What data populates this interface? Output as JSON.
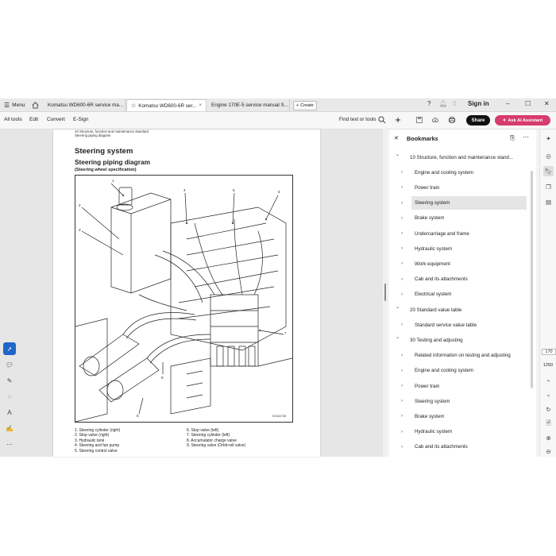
{
  "tabbar": {
    "menu_label": "Menu",
    "tabs": [
      {
        "label": "Komatsu WD600-6R service ma..."
      },
      {
        "label": "Komatsu WD600-6R ser..."
      },
      {
        "label": "Engine 170E-5 service manual S..."
      }
    ],
    "new_tab_label": "Create",
    "sign_in_label": "Sign in"
  },
  "toolbar": {
    "menus": [
      "All tools",
      "Edit",
      "Convert",
      "E-Sign"
    ],
    "find_label": "Find text or tools",
    "share_label": "Share",
    "ai_label": "Ask AI Assistant"
  },
  "document": {
    "header_line1": "10 Structure, function and maintenance standard",
    "header_line2": "Steering piping diagram",
    "title": "Steering system",
    "subtitle": "Steering piping diagram",
    "spec": "(Steering wheel specification)",
    "figure_id": "SJ154738",
    "legend_left": [
      "1.    Steering cylinder (right)",
      "2.    Stop valve (right)",
      "3.    Hydraulic tank",
      "4.    Steering and fan pump",
      "5.    Steering control valve"
    ],
    "legend_right": [
      "6.    Stop valve (left)",
      "7.    Steering cylinder (left)",
      "8.    Accumulator charge valve",
      "9.    Steering valve (Orbit-roll valve)"
    ],
    "callouts": [
      "1",
      "2",
      "3",
      "4",
      "5",
      "6",
      "7",
      "8",
      "9"
    ]
  },
  "bookmarks": {
    "title": "Bookmarks",
    "items": [
      {
        "label": "10 Structure, function and maintenance stand...",
        "level": 0,
        "expanded": true
      },
      {
        "label": "Engine and cooling system",
        "level": 1
      },
      {
        "label": "Power train",
        "level": 1
      },
      {
        "label": "Steering system",
        "level": 1,
        "selected": true
      },
      {
        "label": "Brake system",
        "level": 1
      },
      {
        "label": "Undercarriage and frame",
        "level": 1
      },
      {
        "label": "Hydraulic system",
        "level": 1
      },
      {
        "label": "Work equipment",
        "level": 1
      },
      {
        "label": "Cab and its attachments",
        "level": 1
      },
      {
        "label": "Electrical system",
        "level": 1
      },
      {
        "label": "20 Standard value table",
        "level": 0,
        "expanded": true
      },
      {
        "label": "Standard service value table",
        "level": 1
      },
      {
        "label": "30 Testing and adjusting",
        "level": 0,
        "expanded": true
      },
      {
        "label": "Related information on testing and adjusting",
        "level": 1
      },
      {
        "label": "Engine and cooling system",
        "level": 1
      },
      {
        "label": "Power train",
        "level": 1
      },
      {
        "label": "Steering system",
        "level": 1
      },
      {
        "label": "Brake system",
        "level": 1
      },
      {
        "label": "Hydraulic system",
        "level": 1
      },
      {
        "label": "Cab and its attachments",
        "level": 1
      }
    ]
  },
  "page_nav": {
    "current_page": "170",
    "total_pages": "1250"
  },
  "colors": {
    "accent": "#1f66c9",
    "ai_button": "#d63c6c",
    "share_button": "#111111"
  }
}
